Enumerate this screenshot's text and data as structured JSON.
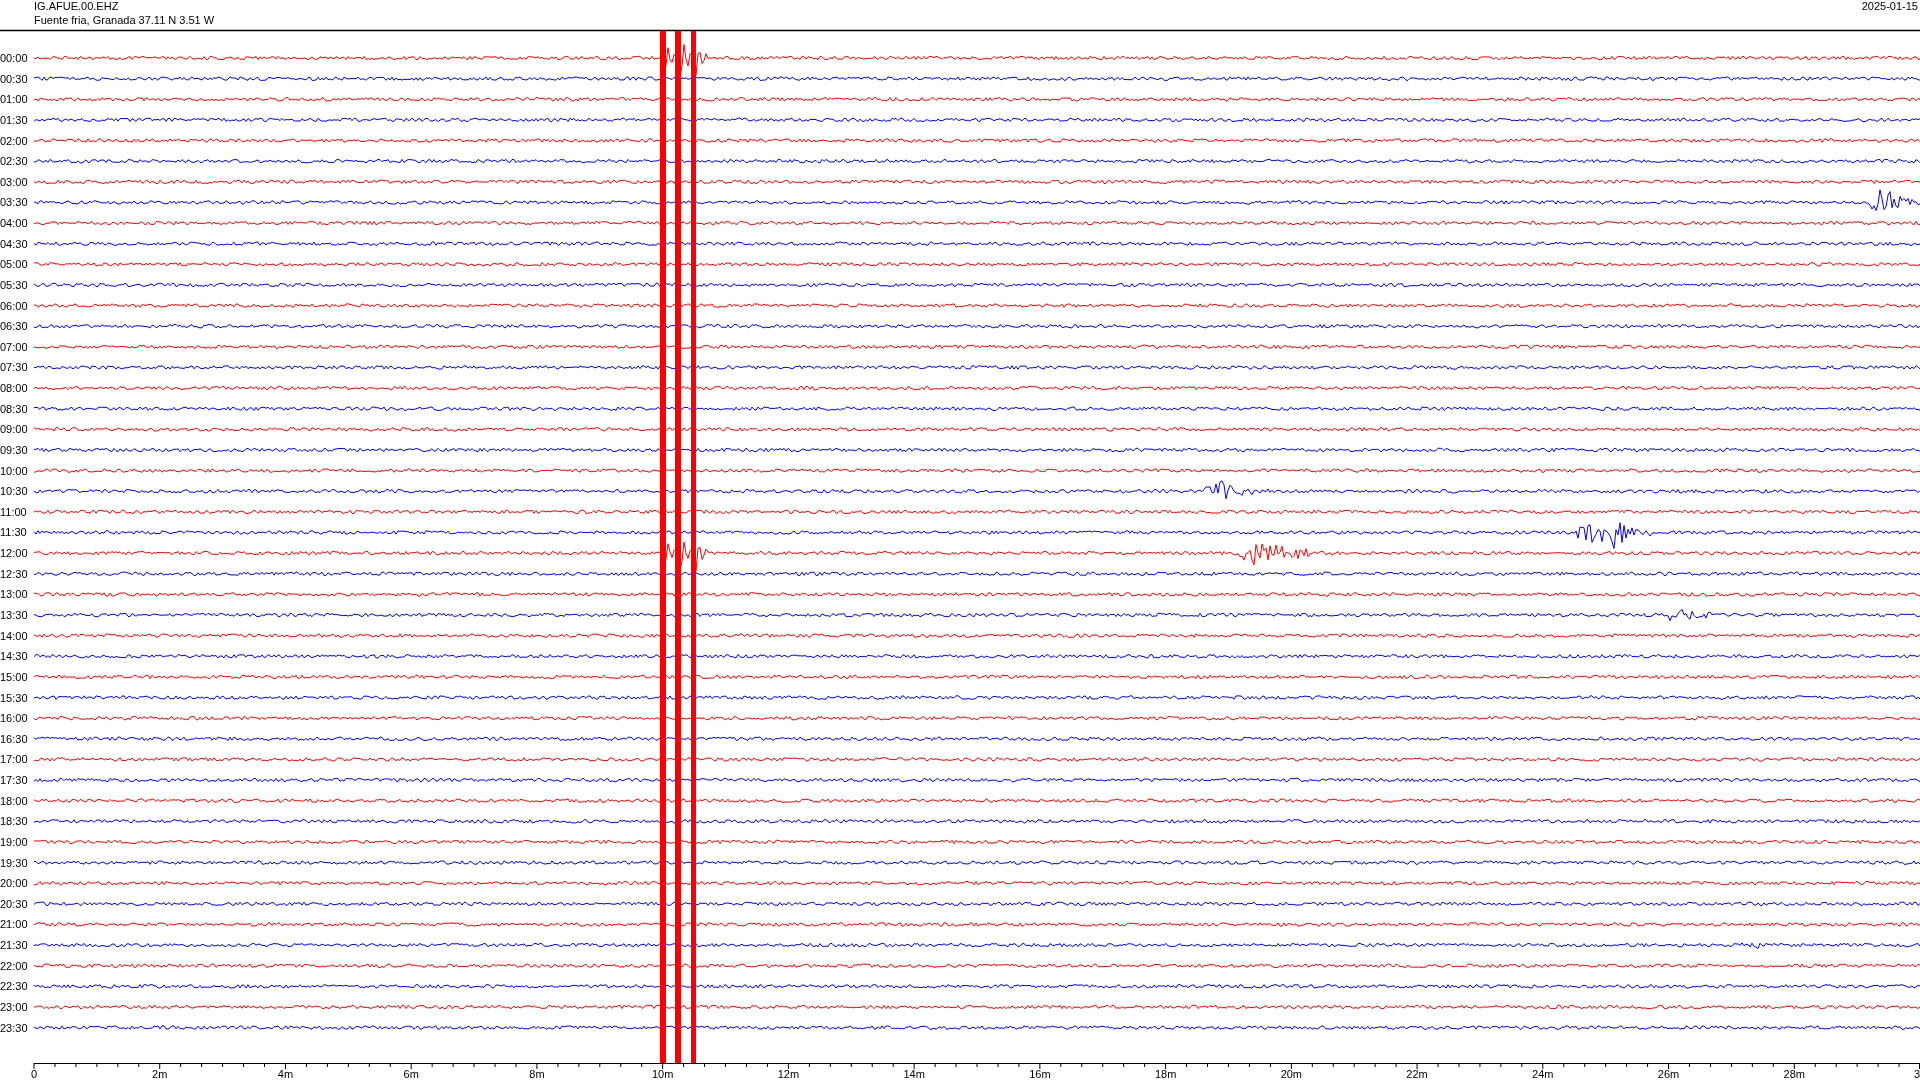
{
  "header": {
    "station": "IG.AFUE.00.EHZ",
    "location": "Fuente fria, Granada  37.11 N 3.51 W",
    "date": "2025-01-15"
  },
  "rows": [
    {
      "label": "00:00",
      "color": "#ff0000"
    },
    {
      "label": "00:30",
      "color": "#0000ff"
    },
    {
      "label": "01:00",
      "color": "#ff0000"
    },
    {
      "label": "01:30",
      "color": "#0000ff"
    },
    {
      "label": "02:00",
      "color": "#ff0000"
    },
    {
      "label": "02:30",
      "color": "#0000ff"
    },
    {
      "label": "03:00",
      "color": "#ff0000"
    },
    {
      "label": "03:30",
      "color": "#0000ff"
    },
    {
      "label": "04:00",
      "color": "#ff0000"
    },
    {
      "label": "04:30",
      "color": "#0000ff"
    },
    {
      "label": "05:00",
      "color": "#ff0000"
    },
    {
      "label": "05:30",
      "color": "#0000ff"
    },
    {
      "label": "06:00",
      "color": "#ff0000"
    },
    {
      "label": "06:30",
      "color": "#0000ff"
    },
    {
      "label": "07:00",
      "color": "#ff0000"
    },
    {
      "label": "07:30",
      "color": "#0000ff"
    },
    {
      "label": "08:00",
      "color": "#ff0000"
    },
    {
      "label": "08:30",
      "color": "#0000ff"
    },
    {
      "label": "09:00",
      "color": "#ff0000"
    },
    {
      "label": "09:30",
      "color": "#0000ff"
    },
    {
      "label": "10:00",
      "color": "#ff0000"
    },
    {
      "label": "10:30",
      "color": "#0000ff"
    },
    {
      "label": "11:00",
      "color": "#ff0000"
    },
    {
      "label": "11:30",
      "color": "#0000ff"
    },
    {
      "label": "12:00",
      "color": "#ff0000"
    },
    {
      "label": "12:30",
      "color": "#0000ff"
    },
    {
      "label": "13:00",
      "color": "#ff0000"
    },
    {
      "label": "13:30",
      "color": "#0000ff"
    },
    {
      "label": "14:00",
      "color": "#ff0000"
    },
    {
      "label": "14:30",
      "color": "#0000ff"
    },
    {
      "label": "15:00",
      "color": "#ff0000"
    },
    {
      "label": "15:30",
      "color": "#0000ff"
    },
    {
      "label": "16:00",
      "color": "#ff0000"
    },
    {
      "label": "16:30",
      "color": "#0000ff"
    },
    {
      "label": "17:00",
      "color": "#ff0000"
    },
    {
      "label": "17:30",
      "color": "#0000ff"
    },
    {
      "label": "18:00",
      "color": "#ff0000"
    },
    {
      "label": "18:30",
      "color": "#0000ff"
    },
    {
      "label": "19:00",
      "color": "#ff0000"
    },
    {
      "label": "19:30",
      "color": "#0000ff"
    },
    {
      "label": "20:00",
      "color": "#ff0000"
    },
    {
      "label": "20:30",
      "color": "#0000ff"
    },
    {
      "label": "21:00",
      "color": "#ff0000"
    },
    {
      "label": "21:30",
      "color": "#0000ff"
    },
    {
      "label": "22:00",
      "color": "#ff0000"
    },
    {
      "label": "22:30",
      "color": "#0000ff"
    },
    {
      "label": "23:00",
      "color": "#ff0000"
    },
    {
      "label": "23:30",
      "color": "#0000ff"
    }
  ],
  "x_axis": {
    "labels": [
      "0",
      "2m",
      "4m",
      "6m",
      "8m",
      "10m",
      "12m",
      "14m",
      "16m",
      "18m",
      "20m",
      "22m",
      "24m",
      "26m",
      "28m",
      "3"
    ]
  }
}
